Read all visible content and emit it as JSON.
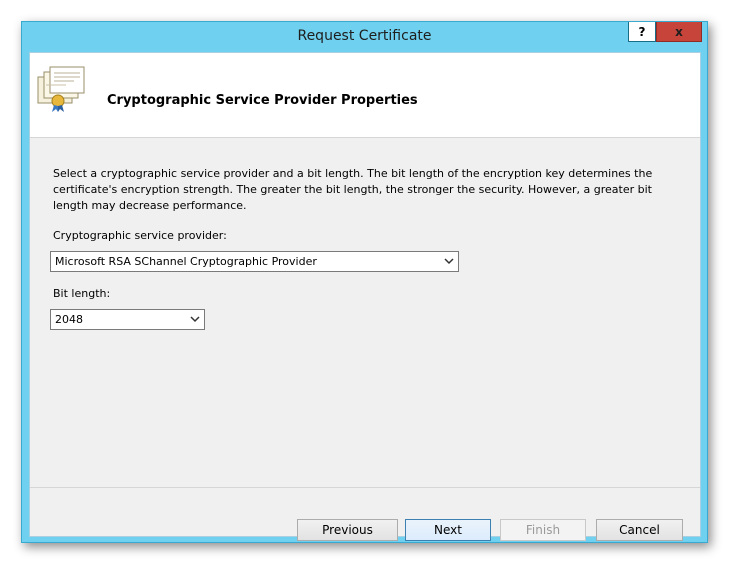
{
  "window": {
    "title": "Request Certificate",
    "help_label": "?",
    "close_label": "x"
  },
  "header": {
    "title": "Cryptographic Service Provider Properties",
    "icon": "certificate-icon"
  },
  "main": {
    "description": "Select a cryptographic service provider and a bit length. The bit length of the encryption key determines the certificate's encryption strength. The greater the bit length, the stronger the security. However, a greater bit length may decrease performance.",
    "csp_label": "Cryptographic service provider:",
    "csp_value": "Microsoft RSA SChannel Cryptographic Provider",
    "bit_length_label": "Bit length:",
    "bit_length_value": "2048"
  },
  "footer": {
    "previous_label": "Previous",
    "next_label": "Next",
    "finish_label": "Finish",
    "cancel_label": "Cancel"
  },
  "colors": {
    "titlebar": "#6fd0ef",
    "close_button": "#c7443a",
    "dialog_background": "#f0f0f0"
  }
}
